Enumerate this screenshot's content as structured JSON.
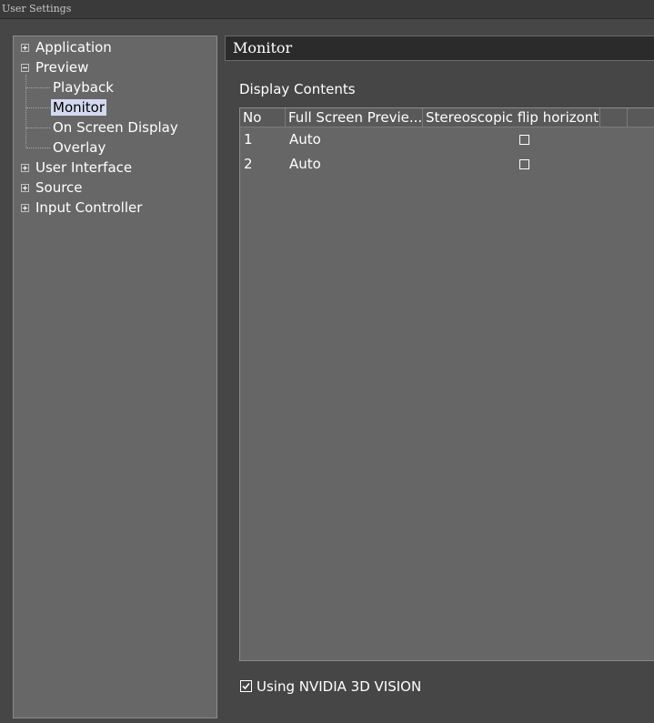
{
  "window": {
    "title": "User Settings"
  },
  "tree": {
    "items": [
      {
        "label": "Application",
        "state": "collapsed"
      },
      {
        "label": "Preview",
        "state": "expanded"
      },
      {
        "label": "Playback"
      },
      {
        "label": "Monitor",
        "selected": true
      },
      {
        "label": "On Screen Display"
      },
      {
        "label": "Overlay"
      },
      {
        "label": "User Interface",
        "state": "collapsed"
      },
      {
        "label": "Source",
        "state": "collapsed"
      },
      {
        "label": "Input Controller",
        "state": "collapsed"
      }
    ]
  },
  "panel": {
    "title": "Monitor",
    "section_label": "Display Contents"
  },
  "grid": {
    "columns": [
      "No",
      "Full Screen Previe...",
      "Stereoscopic flip horizontal"
    ],
    "rows": [
      {
        "no": "1",
        "mode": "Auto",
        "flip": false
      },
      {
        "no": "2",
        "mode": "Auto",
        "flip": false
      }
    ]
  },
  "nvidia": {
    "label": "Using NVIDIA 3D VISION",
    "checked": true
  },
  "colors": {
    "selection": "#d4d9f0",
    "header_bar": "#2b2b2b",
    "panel_bg": "#676767",
    "window_bg": "#464646"
  }
}
